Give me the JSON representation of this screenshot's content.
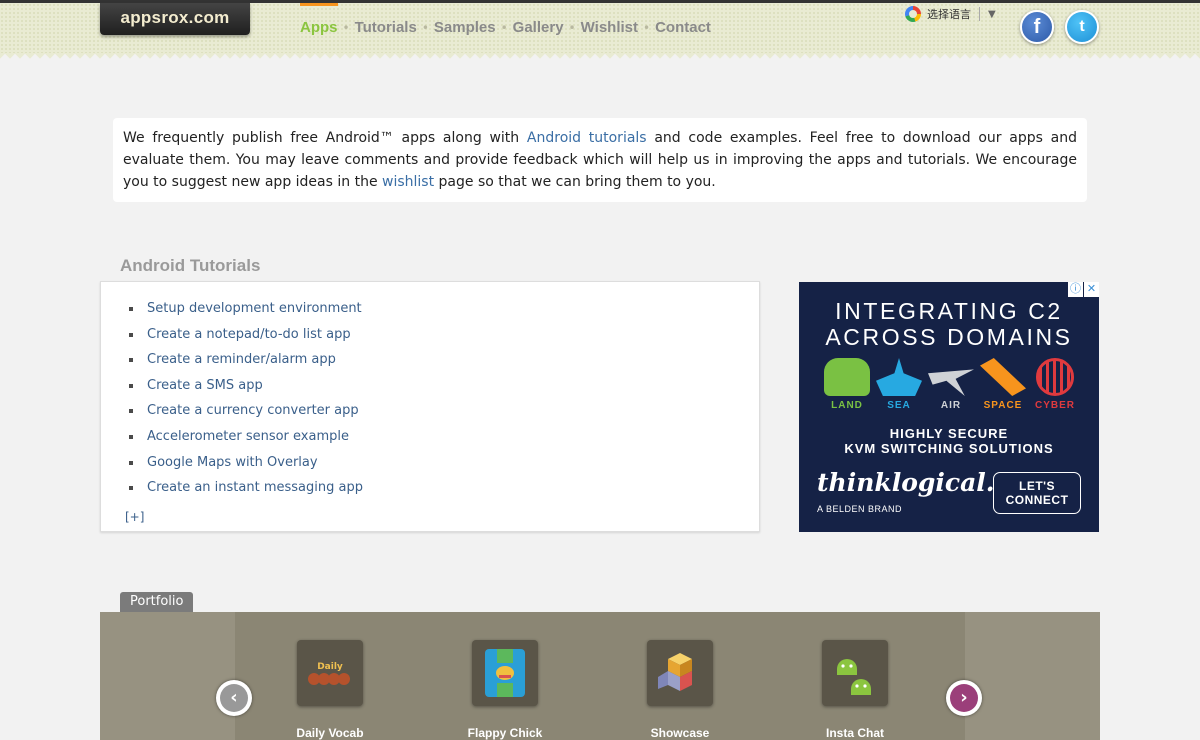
{
  "header": {
    "logo": "appsrox.com",
    "nav": [
      {
        "label": "Apps",
        "active": true
      },
      {
        "label": "Tutorials",
        "active": false
      },
      {
        "label": "Samples",
        "active": false
      },
      {
        "label": "Gallery",
        "active": false
      },
      {
        "label": "Wishlist",
        "active": false
      },
      {
        "label": "Contact",
        "active": false
      }
    ],
    "nav_separator": "•",
    "translate_label": "选择语言",
    "translate_arrow": "▼",
    "social": {
      "facebook": "f",
      "twitter": "t"
    }
  },
  "intro": {
    "part1": "We frequently publish free Android™ apps along with ",
    "link1": "Android tutorials",
    "part2": " and code examples. Feel free to download our apps and evaluate them. You may leave comments and provide feedback which will help us in improving the apps and tutorials. We encourage you to suggest new app ideas in the ",
    "link2": "wishlist",
    "part3": " page so that we can bring them to you."
  },
  "tutorials": {
    "title": "Android Tutorials",
    "items": [
      "Setup development environment",
      "Create a notepad/to-do list app",
      "Create a reminder/alarm app",
      "Create a SMS app",
      "Create a currency converter app",
      "Accelerometer sensor example",
      "Google Maps with Overlay",
      "Create an instant messaging app"
    ],
    "more": "[+]"
  },
  "ad": {
    "badge_info": "ⓘ",
    "badge_close": "✕",
    "headline_1": "INTEGRATING C2",
    "headline_2": "ACROSS DOMAINS",
    "domains": [
      "LAND",
      "SEA",
      "AIR",
      "SPACE",
      "CYBER"
    ],
    "domain_colors": [
      "#7ac143",
      "#27a9e1",
      "#cfd2d6",
      "#f7941d",
      "#e03a3e"
    ],
    "sub_1": "HIGHLY SECURE",
    "sub_2": "KVM SWITCHING SOLUTIONS",
    "brand": "thinklogical.",
    "brand_sub": "A BELDEN BRAND",
    "cta_1": "LET'S",
    "cta_2": "CONNECT"
  },
  "portfolio": {
    "tab": "Portfolio",
    "prev_icon": "‹",
    "next_icon": "›",
    "apps": [
      {
        "name": "Daily Vocab",
        "icon": "daily-vocab-icon"
      },
      {
        "name": "Flappy Chick",
        "icon": "flappy-chick-icon"
      },
      {
        "name": "Showcase",
        "icon": "showcase-icon"
      },
      {
        "name": "Insta Chat",
        "icon": "insta-chat-icon"
      }
    ]
  }
}
